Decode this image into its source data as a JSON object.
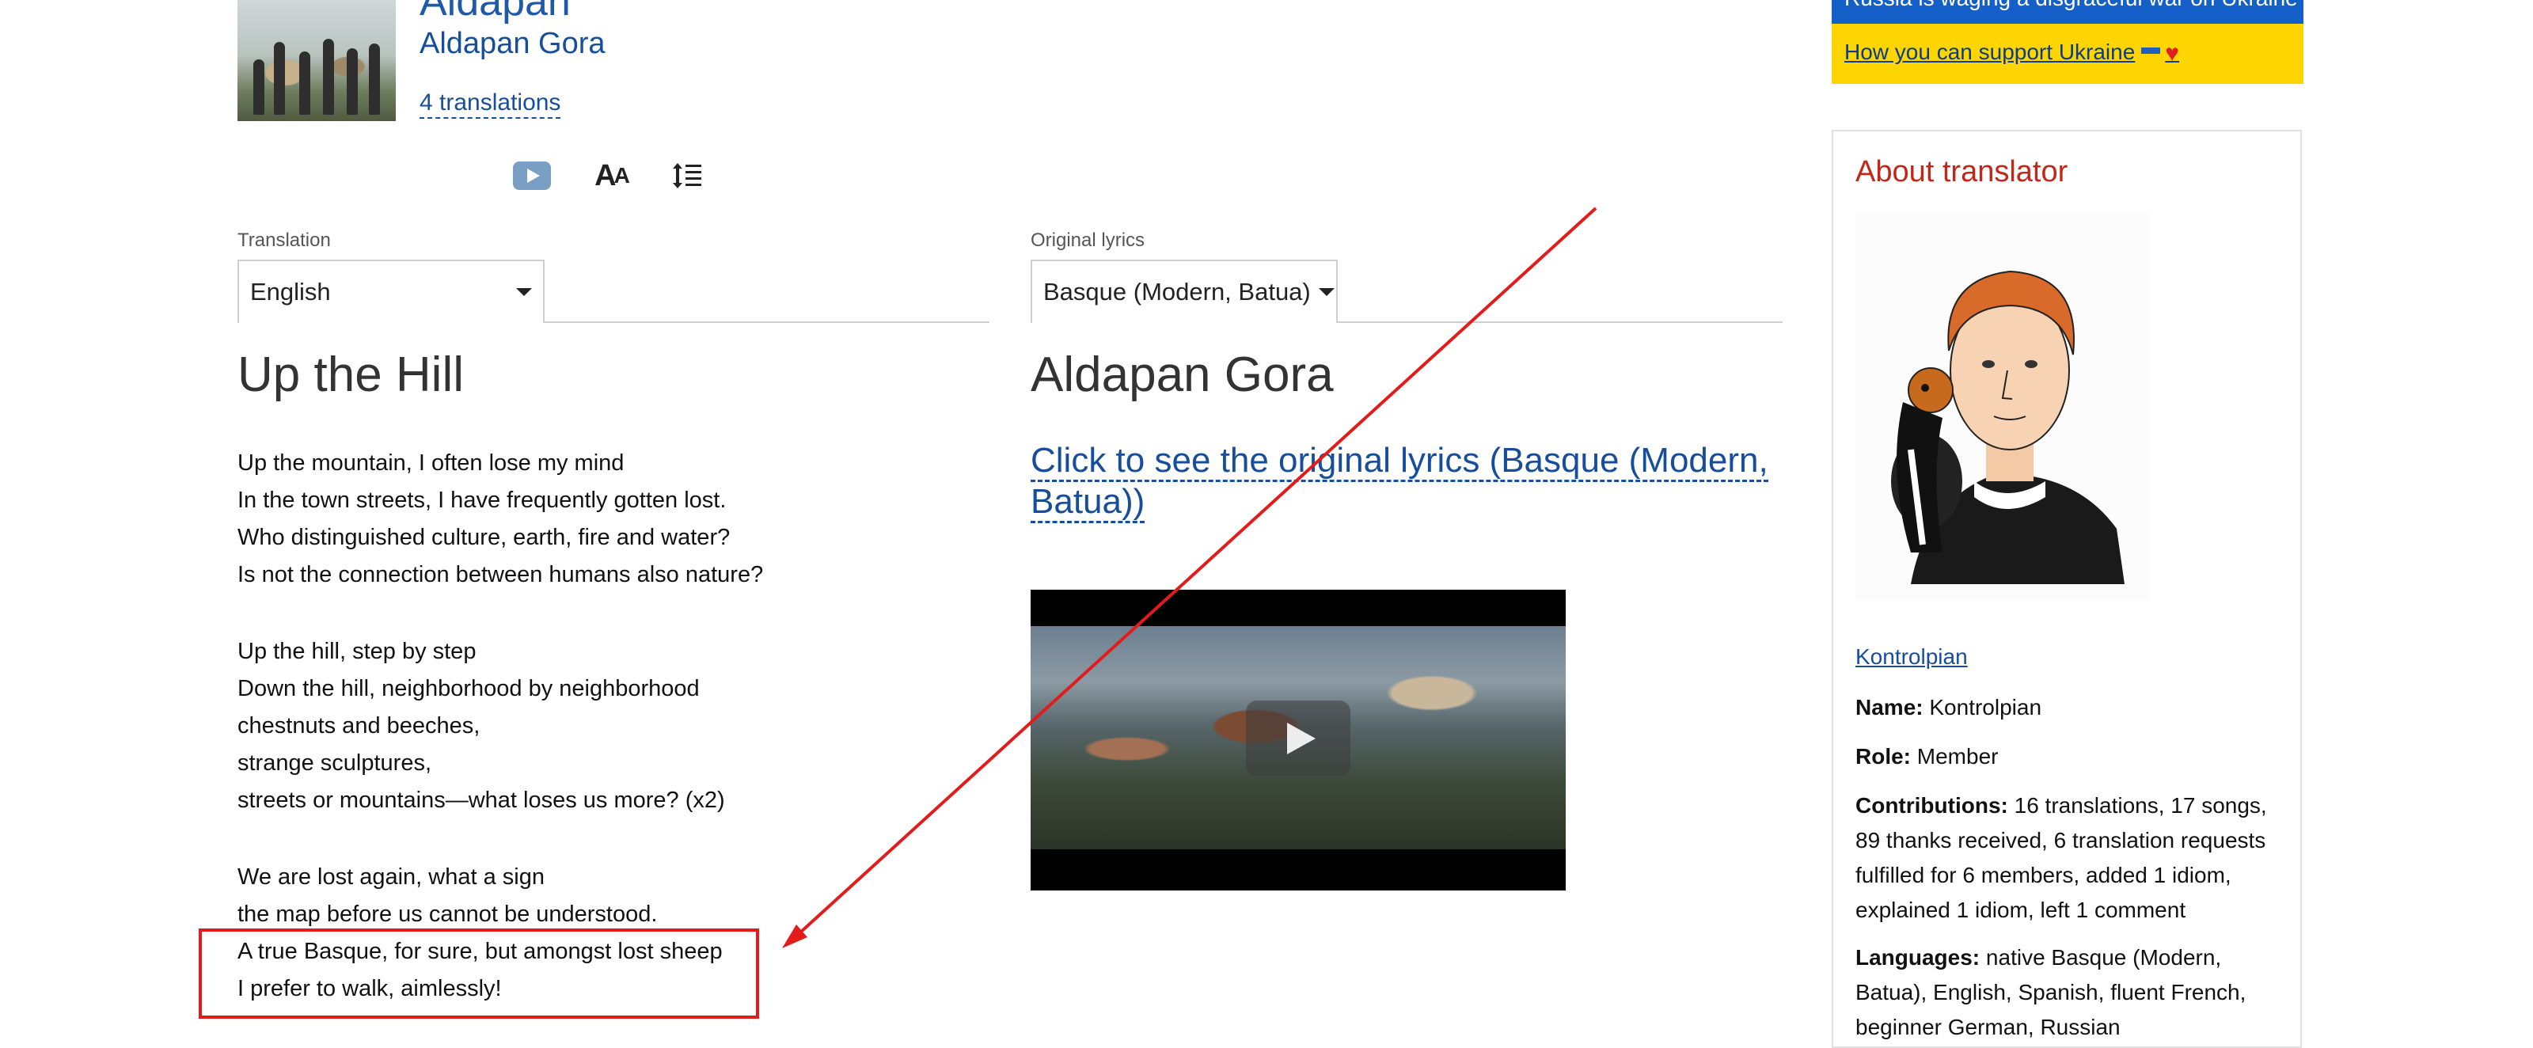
{
  "song": {
    "title_partial": "Aldapan",
    "artist": "Aldapan Gora",
    "translations_link": "4 translations"
  },
  "toolbar": {
    "video_icon": "youtube-icon",
    "font_size_icon": "font-size-icon",
    "font_size_glyph_big": "A",
    "font_size_glyph_small": "A",
    "line_spacing_icon": "line-spacing-icon"
  },
  "translation": {
    "label": "Translation",
    "selected_language": "English",
    "title": "Up the Hill",
    "stanzas": [
      [
        "Up the mountain, I often lose my mind",
        "In the town streets, I have frequently gotten lost.",
        "Who distinguished culture, earth, fire and water?",
        "Is not the connection between humans also nature?"
      ],
      [
        "Up the hill, step by step",
        "Down the hill, neighborhood by neighborhood",
        "chestnuts and beeches,",
        "strange sculptures,",
        "streets or mountains—what loses us more? (x2)"
      ],
      [
        "We are lost again, what a sign",
        "the map before us cannot be understood.",
        "A true Basque, for sure, but amongst lost sheep",
        "I prefer to walk, aimlessly!"
      ]
    ]
  },
  "original": {
    "label": "Original lyrics",
    "selected_language": "Basque (Modern, Batua)",
    "title": "Aldapan Gora",
    "reveal_link": "Click to see the original lyrics (Basque (Modern, Batua))"
  },
  "sidebar": {
    "banner_text": "Russia is waging a disgraceful war on Ukraine",
    "support_link": "How you can support Ukraine",
    "about_title": "About translator",
    "translator_name_link": "Kontrolpian",
    "name_label": "Name:",
    "name_value": "Kontrolpian",
    "role_label": "Role:",
    "role_value": "Member",
    "contributions_label": "Contributions:",
    "contributions_value": "16 translations, 17 songs, 89 thanks received, 6 translation requests fulfilled for 6 members, added 1 idiom, explained 1 idiom, left 1 comment",
    "languages_label": "Languages:",
    "languages_value": "native Basque (Modern, Batua), English, Spanish, fluent French, beginner German, Russian"
  },
  "colors": {
    "link": "#174e9b",
    "about_title": "#c0281a",
    "annotation": "#e21b1b",
    "ukraine_blue": "#1460c8",
    "ukraine_yellow": "#ffd500"
  }
}
